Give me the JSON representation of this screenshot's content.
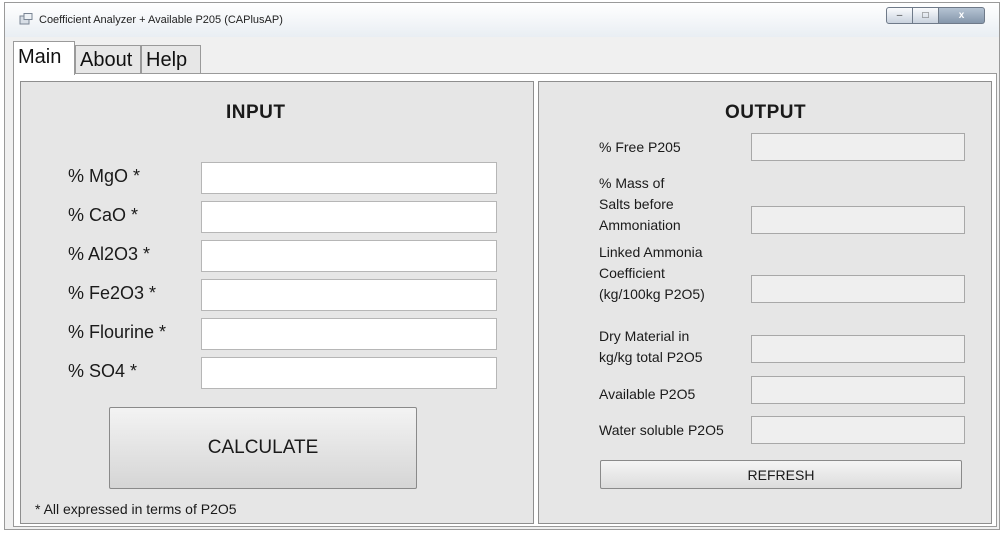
{
  "window": {
    "title": "Coefficient Analyzer + Available P205 (CAPlusAP)",
    "controls": {
      "minimize": "–",
      "maximize": "□",
      "close": "x"
    }
  },
  "tabs": [
    {
      "label": "Main"
    },
    {
      "label": "About"
    },
    {
      "label": "Help"
    }
  ],
  "input": {
    "heading": "INPUT",
    "fields": [
      {
        "label": "% MgO *",
        "value": ""
      },
      {
        "label": "% CaO *",
        "value": ""
      },
      {
        "label": "% Al2O3 *",
        "value": ""
      },
      {
        "label": "% Fe2O3 *",
        "value": ""
      },
      {
        "label": "% Flourine *",
        "value": ""
      },
      {
        "label": "% SO4 *",
        "value": ""
      }
    ],
    "calculate_label": "CALCULATE",
    "footnote": "* All expressed in terms of P2O5"
  },
  "output": {
    "heading": "OUTPUT",
    "fields": [
      {
        "label": "% Free P205",
        "value": ""
      },
      {
        "label": "% Mass of\nSalts before\nAmmoniation",
        "value": ""
      },
      {
        "label": "Linked Ammonia\nCoefficient\n(kg/100kg P2O5)",
        "value": ""
      },
      {
        "label": "Dry Material in\nkg/kg total P2O5",
        "value": ""
      },
      {
        "label": "Available P2O5",
        "value": ""
      },
      {
        "label": "Water soluble P2O5",
        "value": ""
      }
    ],
    "refresh_label": "REFRESH"
  }
}
